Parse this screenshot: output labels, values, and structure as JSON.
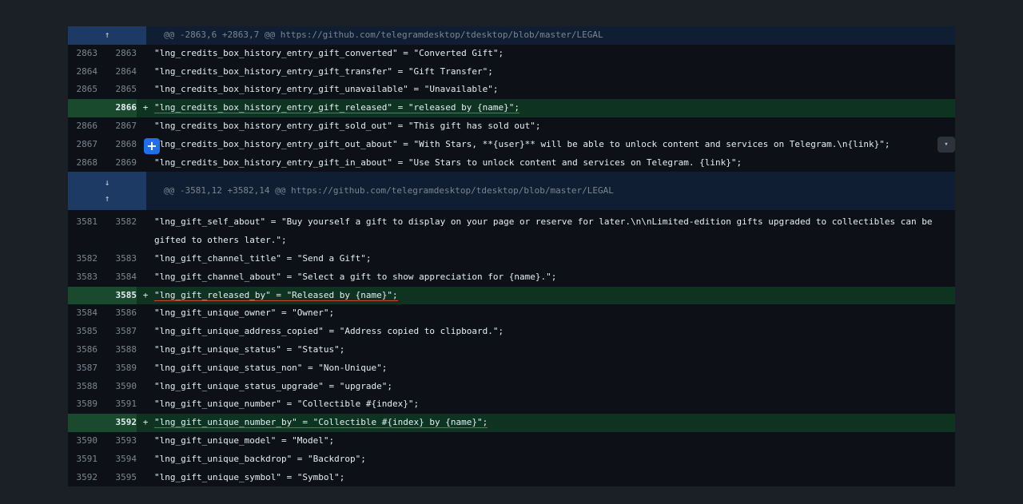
{
  "diff": {
    "hunk1": {
      "header": "@@ -2863,6 +2863,7 @@ https://github.com/telegramdesktop/tdesktop/blob/master/LEGAL",
      "expand_up_icon": "↑"
    },
    "rows1": [
      {
        "old": "2863",
        "new": "2863",
        "marker": "",
        "code": "\"lng_credits_box_history_entry_gift_converted\" = \"Converted Gift\";"
      },
      {
        "old": "2864",
        "new": "2864",
        "marker": "",
        "code": "\"lng_credits_box_history_entry_gift_transfer\" = \"Gift Transfer\";"
      },
      {
        "old": "2865",
        "new": "2865",
        "marker": "",
        "code": "\"lng_credits_box_history_entry_gift_unavailable\" = \"Unavailable\";"
      },
      {
        "old": "",
        "new": "2866",
        "marker": "+",
        "code": "\"lng_credits_box_history_entry_gift_released\" = \"released by {name}\";"
      },
      {
        "old": "2866",
        "new": "2867",
        "marker": "",
        "code": "\"lng_credits_box_history_entry_gift_sold_out\" = \"This gift has sold out\";"
      },
      {
        "old": "2867",
        "new": "2868",
        "marker": "",
        "code": "\"lng_credits_box_history_entry_gift_out_about\" = \"With Stars, **{user}** will be able to unlock content and services on Telegram.\\n{link}\";"
      },
      {
        "old": "2868",
        "new": "2869",
        "marker": "",
        "code": "\"lng_credits_box_history_entry_gift_in_about\" = \"Use Stars to unlock content and services on Telegram. {link}\";"
      }
    ],
    "hunk2": {
      "header": "@@ -3581,12 +3582,14 @@ https://github.com/telegramdesktop/tdesktop/blob/master/LEGAL",
      "expand_down_icon": "↓",
      "expand_up_icon": "↑"
    },
    "rows2": [
      {
        "old": "3581",
        "new": "3582",
        "marker": "",
        "code": "\"lng_gift_self_about\" = \"Buy yourself a gift to display on your page or reserve for later.\\n\\nLimited-edition gifts upgraded to collectibles can be gifted to others later.\";"
      },
      {
        "old": "3582",
        "new": "3583",
        "marker": "",
        "code": "\"lng_gift_channel_title\" = \"Send a Gift\";"
      },
      {
        "old": "3583",
        "new": "3584",
        "marker": "",
        "code": "\"lng_gift_channel_about\" = \"Select a gift to show appreciation for {name}.\";"
      },
      {
        "old": "",
        "new": "3585",
        "marker": "+",
        "code": "\"lng_gift_released_by\" = \"Released by {name}\";"
      },
      {
        "old": "3584",
        "new": "3586",
        "marker": "",
        "code": "\"lng_gift_unique_owner\" = \"Owner\";"
      },
      {
        "old": "3585",
        "new": "3587",
        "marker": "",
        "code": "\"lng_gift_unique_address_copied\" = \"Address copied to clipboard.\";"
      },
      {
        "old": "3586",
        "new": "3588",
        "marker": "",
        "code": "\"lng_gift_unique_status\" = \"Status\";"
      },
      {
        "old": "3587",
        "new": "3589",
        "marker": "",
        "code": "\"lng_gift_unique_status_non\" = \"Non-Unique\";"
      },
      {
        "old": "3588",
        "new": "3590",
        "marker": "",
        "code": "\"lng_gift_unique_status_upgrade\" = \"upgrade\";"
      },
      {
        "old": "3589",
        "new": "3591",
        "marker": "",
        "code": "\"lng_gift_unique_number\" = \"Collectible #{index}\";"
      },
      {
        "old": "",
        "new": "3592",
        "marker": "+",
        "code": "\"lng_gift_unique_number_by\" = \"Collectible #{index} by {name}\";"
      },
      {
        "old": "3590",
        "new": "3593",
        "marker": "",
        "code": "\"lng_gift_unique_model\" = \"Model\";"
      },
      {
        "old": "3591",
        "new": "3594",
        "marker": "",
        "code": "\"lng_gift_unique_backdrop\" = \"Backdrop\";"
      },
      {
        "old": "3592",
        "new": "3595",
        "marker": "",
        "code": "\"lng_gift_unique_symbol\" = \"Symbol\";"
      }
    ],
    "add_comment_icon": "+",
    "collapse_icon": "▾"
  },
  "colors": {
    "background": "#0d1117",
    "added_line": "#0f3321",
    "hunk_header": "#0f1e33",
    "annotation_underline": "#e5372b",
    "accent": "#1f6feb"
  }
}
